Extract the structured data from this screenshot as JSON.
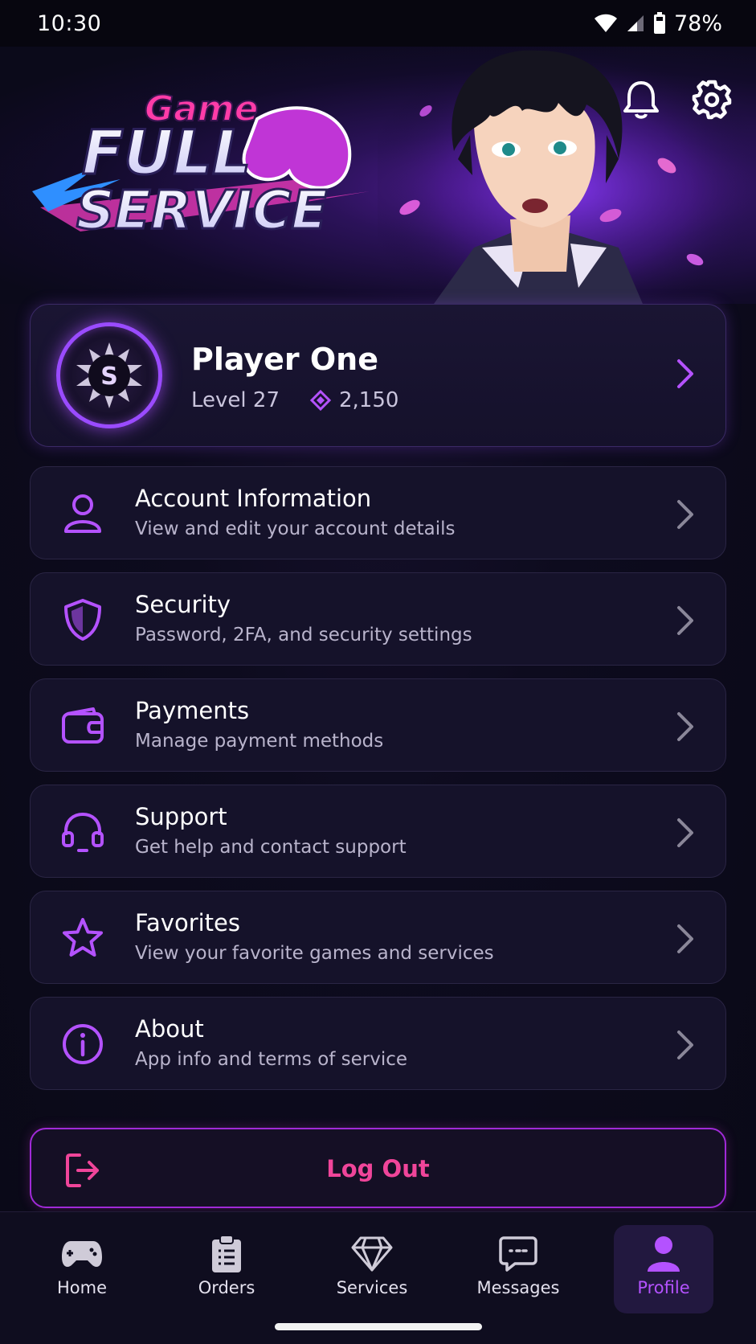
{
  "status_bar": {
    "time": "10:30",
    "battery": "78%"
  },
  "hero": {
    "logo_text": [
      "Game",
      "FULL",
      "SERVICE"
    ],
    "icons": [
      "bell-icon",
      "gear-icon"
    ]
  },
  "profile": {
    "name": "Player One",
    "level": "Level 27",
    "gems": "2,150"
  },
  "menu": [
    {
      "title": "Account Information",
      "subtitle": "View and edit your account details",
      "icon": "user-icon"
    },
    {
      "title": "Security",
      "subtitle": "Password, 2FA, and security settings",
      "icon": "shield-icon"
    },
    {
      "title": "Payments",
      "subtitle": "Manage payment methods",
      "icon": "wallet-icon"
    },
    {
      "title": "Support",
      "subtitle": "Get help and contact support",
      "icon": "headset-icon"
    },
    {
      "title": "Favorites",
      "subtitle": "View your favorite games and services",
      "icon": "star-icon"
    },
    {
      "title": "About",
      "subtitle": "App info and terms of service",
      "icon": "info-icon"
    }
  ],
  "logout": {
    "label": "Log Out"
  },
  "bottom_nav": [
    {
      "label": "Home",
      "icon": "gamepad-icon"
    },
    {
      "label": "Orders",
      "icon": "clipboard-icon"
    },
    {
      "label": "Services",
      "icon": "diamond-icon"
    },
    {
      "label": "Messages",
      "icon": "message-icon"
    },
    {
      "label": "Profile",
      "icon": "profile-icon",
      "active": true
    }
  ],
  "colors": {
    "accent": "#b452ff",
    "logout": "#f0459a",
    "background": "#0c0a1c"
  }
}
